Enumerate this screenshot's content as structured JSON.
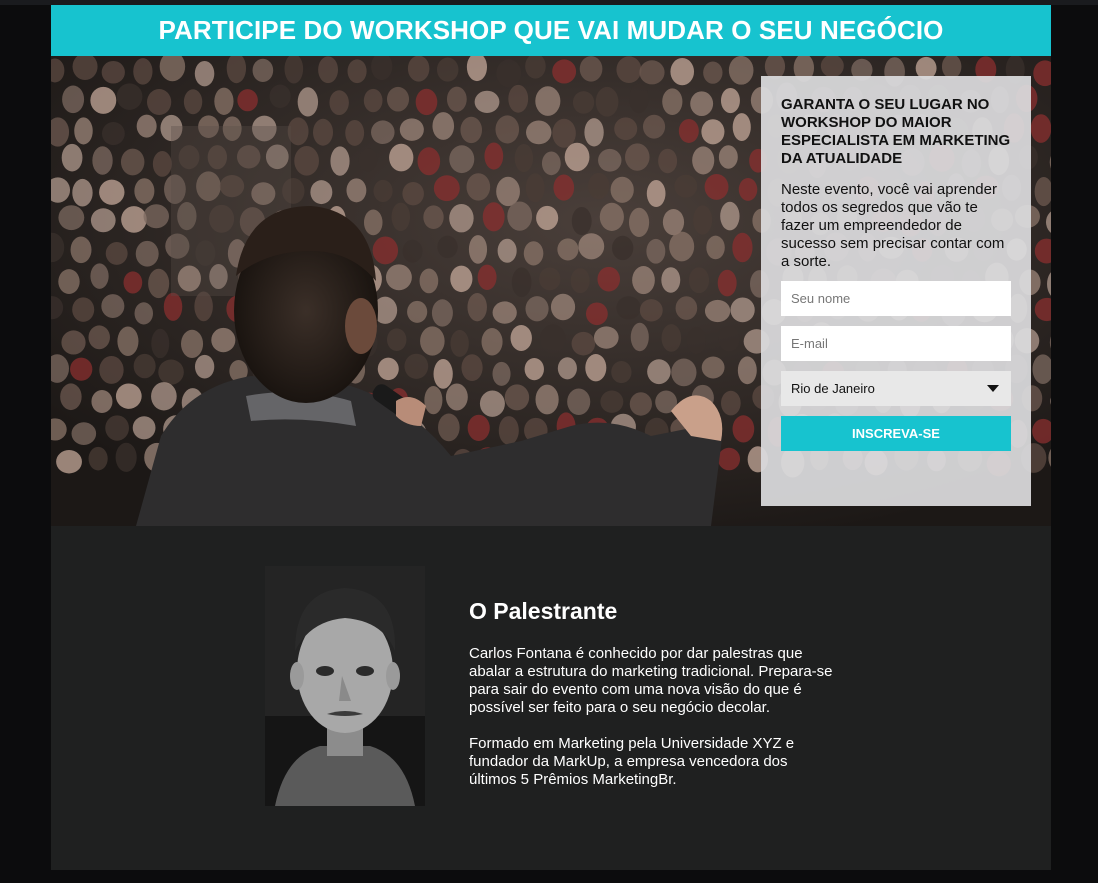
{
  "header": {
    "title": "PARTICIPE DO WORKSHOP QUE VAI MUDAR O SEU NEGÓCIO"
  },
  "form": {
    "title": "GARANTA O SEU LUGAR NO WORKSHOP DO MAIOR ESPECIALISTA EM MARKETING DA ATUALIDADE",
    "description": "Neste evento, você vai aprender todos os segredos que vão te fazer um empreendedor de sucesso sem precisar contar com a sorte.",
    "name_placeholder": "Seu nome",
    "email_placeholder": "E-mail",
    "city_selected": "Rio de Janeiro",
    "submit_label": "INSCREVA-SE"
  },
  "speaker": {
    "heading": "O Palestrante",
    "bio_1": "Carlos Fontana é conhecido por dar palestras que abalar a estrutura do marketing tradicional. Prepara-se para sair do evento com uma nova visão do que é possível ser feito para o seu negócio decolar.",
    "bio_2": "Formado em Marketing pela Universidade XYZ e fundador da MarkUp, a empresa vencedora dos últimos 5 Prêmios MarketingBr."
  },
  "colors": {
    "accent": "#17c3cf",
    "dark_bg": "#1f2020"
  },
  "icons": {
    "select_caret": "caret-down-icon"
  }
}
